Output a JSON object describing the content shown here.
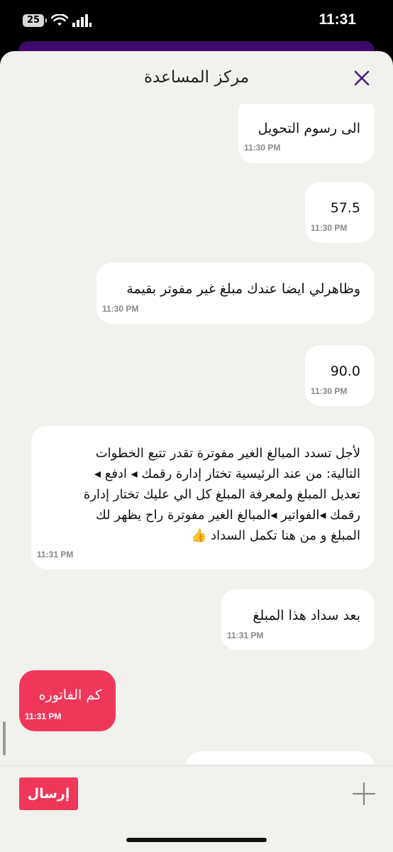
{
  "status_bar": {
    "battery": "25",
    "time": "11:31"
  },
  "header": {
    "title": "مركز المساعدة"
  },
  "messages": [
    {
      "text": "الى رسوم التحويل",
      "time": "11:30 PM"
    },
    {
      "text": "57.5",
      "time": "11:30 PM"
    },
    {
      "text": "وظاهرلي ايضا عندك مبلغ غير مفوتر بقيمة",
      "time": "11:30 PM"
    },
    {
      "text": "90.0",
      "time": "11:30 PM"
    },
    {
      "text": "لأجل تسدد المبالغ الغير مفوترة تقدر تتبع الخطوات\nالتالية: من عند الرئيسية تختار إدارة رقمك ◂ ادفع ◂\nتعديل المبلغ ولمعرفة المبلغ كل الي عليك تختار إدارة\nرقمك ◂الفواتير ◂المبالغ الغير مفوترة راح يظهر لك\nالمبلغ و من هنا تكمل السداد 👍",
      "time": "11:31 PM"
    },
    {
      "text": "بعد سداد هذا المبلغ",
      "time": "11:31 PM"
    },
    {
      "text": "كم الفاتوره",
      "time": "11:31 PM"
    }
  ],
  "composer": {
    "send_label": "إرسال"
  },
  "icons": {
    "close": "close-icon",
    "add": "plus-icon",
    "wifi": "wifi-icon",
    "signal": "signal-icon"
  },
  "colors": {
    "accent_pink": "#f0375a",
    "brand_purple": "#3e0b6b",
    "close_icon": "#4b1f7a"
  }
}
